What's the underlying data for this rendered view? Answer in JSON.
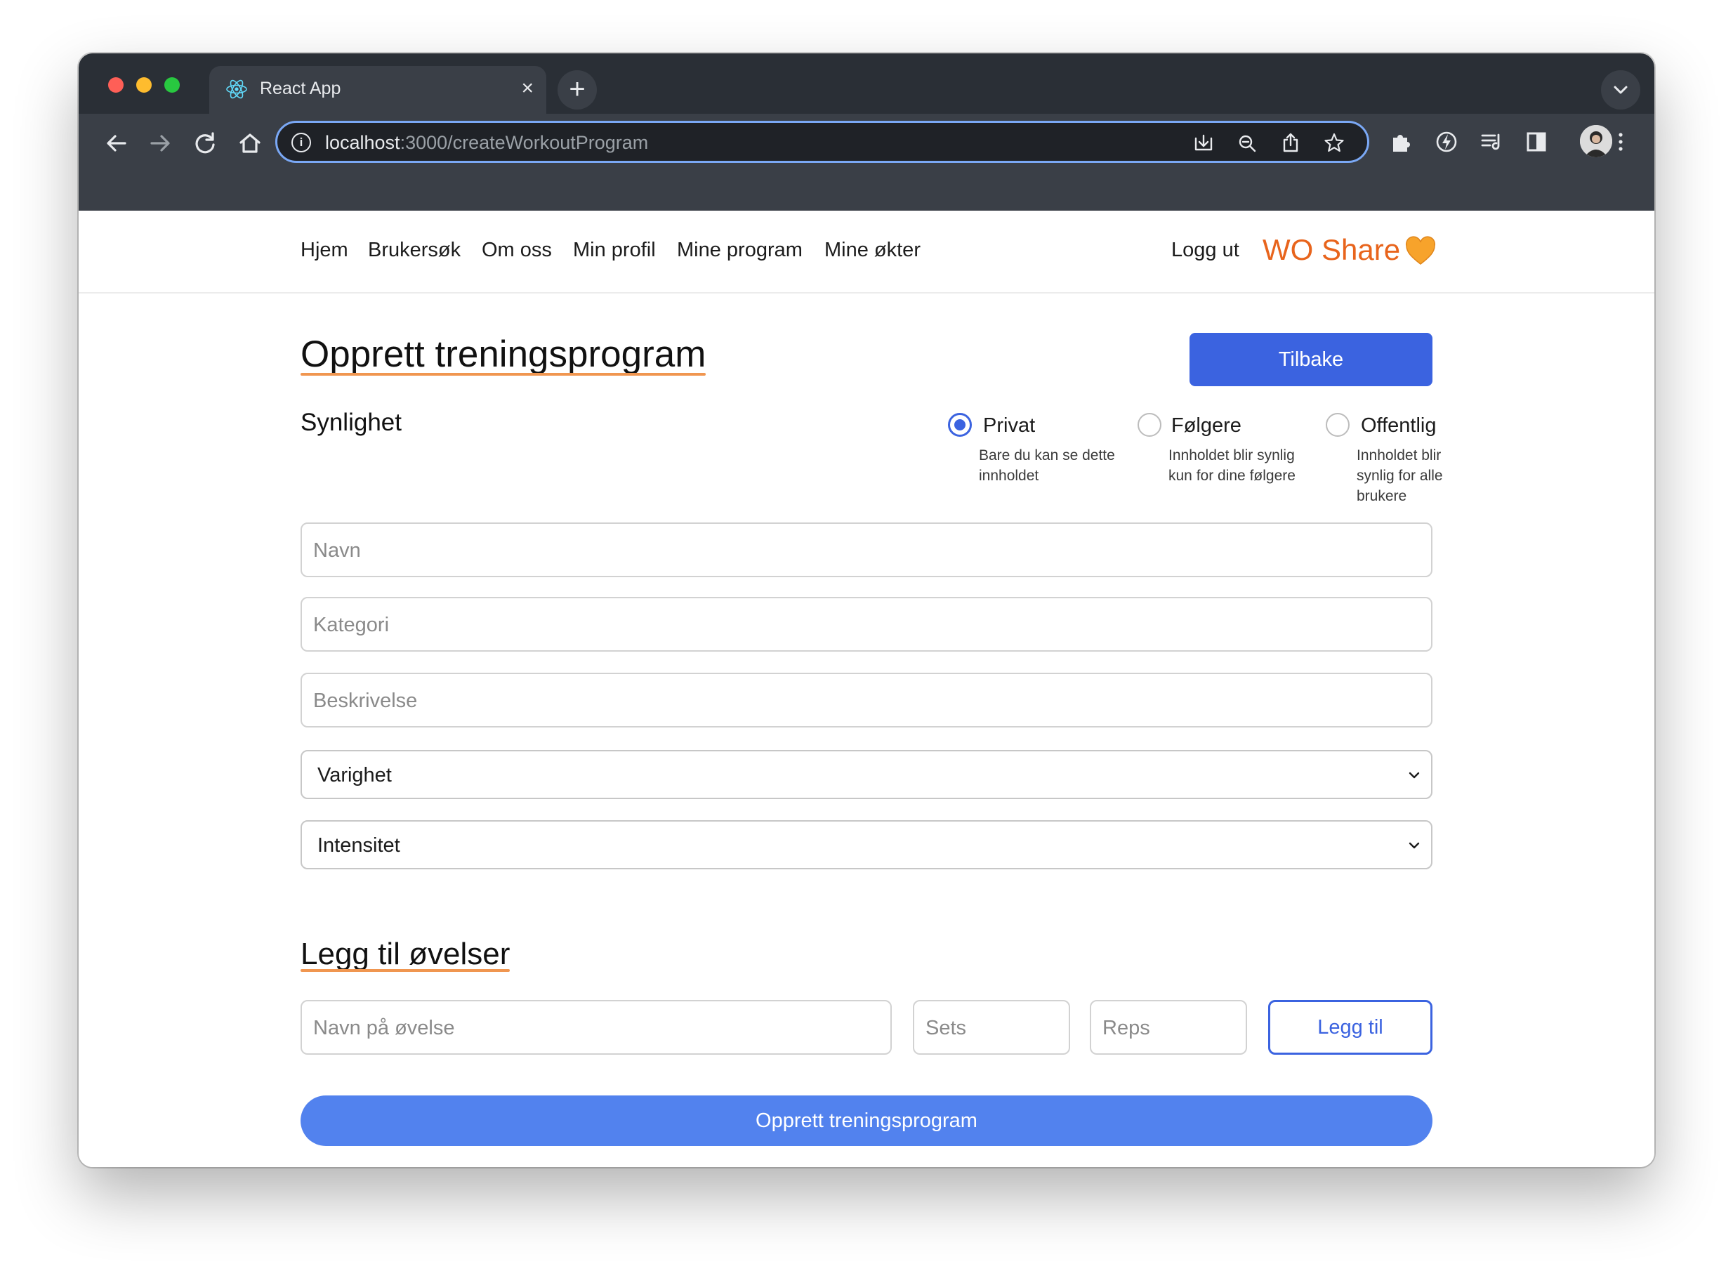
{
  "browser": {
    "tab_title": "React App",
    "url_host": "localhost",
    "url_rest": ":3000/createWorkoutProgram"
  },
  "nav": {
    "links": [
      "Hjem",
      "Brukersøk",
      "Om oss",
      "Min profil",
      "Mine program",
      "Mine økter"
    ],
    "logout": "Logg ut",
    "brand": "WO Share"
  },
  "form": {
    "title": "Opprett treningsprogram",
    "back_button": "Tilbake",
    "visibility_label": "Synlighet",
    "visibility_options": [
      {
        "label": "Privat",
        "desc": "Bare du kan se dette innholdet",
        "checked": true
      },
      {
        "label": "Følgere",
        "desc": "Innholdet blir synlig kun for dine følgere",
        "checked": false
      },
      {
        "label": "Offentlig",
        "desc": "Innholdet blir synlig for alle brukere",
        "checked": false
      }
    ],
    "name_placeholder": "Navn",
    "category_placeholder": "Kategori",
    "description_placeholder": "Beskrivelse",
    "duration_select": "Varighet",
    "intensity_select": "Intensitet"
  },
  "exercises": {
    "heading": "Legg til øvelser",
    "name_placeholder": "Navn på øvelse",
    "sets_placeholder": "Sets",
    "reps_placeholder": "Reps",
    "add_button": "Legg til"
  },
  "submit_button": "Opprett treningsprogram",
  "colors": {
    "primary": "#3b63e0",
    "submit": "#5282ee",
    "brand": "#e8641c",
    "underline": "#f09650"
  }
}
